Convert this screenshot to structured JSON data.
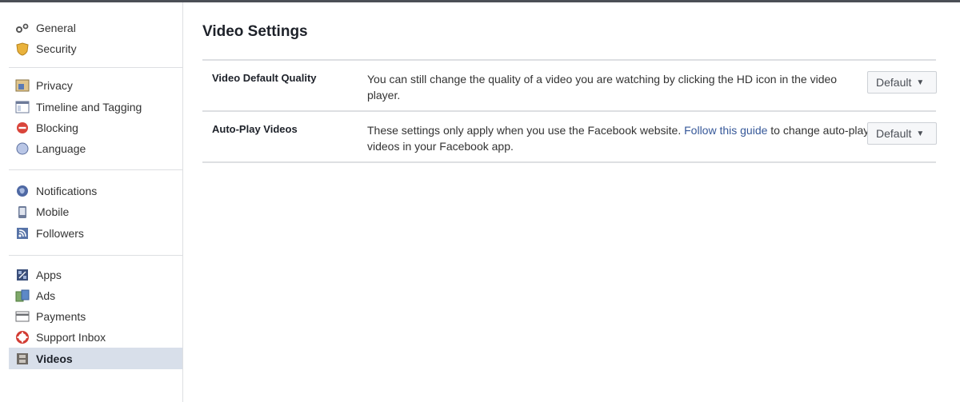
{
  "sidebar": {
    "groups": [
      [
        {
          "label": "General",
          "icon": "gear-icon"
        },
        {
          "label": "Security",
          "icon": "shield-icon"
        }
      ],
      [
        {
          "label": "Privacy",
          "icon": "lock-icon"
        },
        {
          "label": "Timeline and Tagging",
          "icon": "timeline-icon"
        },
        {
          "label": "Blocking",
          "icon": "blocking-icon"
        },
        {
          "label": "Language",
          "icon": "globe-icon"
        }
      ],
      [
        {
          "label": "Notifications",
          "icon": "notifications-globe-icon"
        },
        {
          "label": "Mobile",
          "icon": "mobile-icon"
        },
        {
          "label": "Followers",
          "icon": "rss-icon"
        }
      ],
      [
        {
          "label": "Apps",
          "icon": "apps-icon"
        },
        {
          "label": "Ads",
          "icon": "ads-icon"
        },
        {
          "label": "Payments",
          "icon": "card-icon"
        },
        {
          "label": "Support Inbox",
          "icon": "lifebuoy-icon"
        },
        {
          "label": "Videos",
          "icon": "film-icon",
          "active": true
        }
      ]
    ]
  },
  "main": {
    "title": "Video Settings",
    "rows": [
      {
        "label": "Video Default Quality",
        "description": "You can still change the quality of a video you are watching by clicking the HD icon in the video player.",
        "control": "Default"
      },
      {
        "label": "Auto-Play Videos",
        "description_before": "These settings only apply when you use the Facebook website. ",
        "link": "Follow this guide",
        "description_after": " to change auto-play videos in your Facebook app.",
        "control": "Default"
      }
    ],
    "caret": "▼"
  },
  "colors": {
    "accent_link": "#365899",
    "active_bg": "#d8dfea",
    "divider": "#dddfe2"
  }
}
